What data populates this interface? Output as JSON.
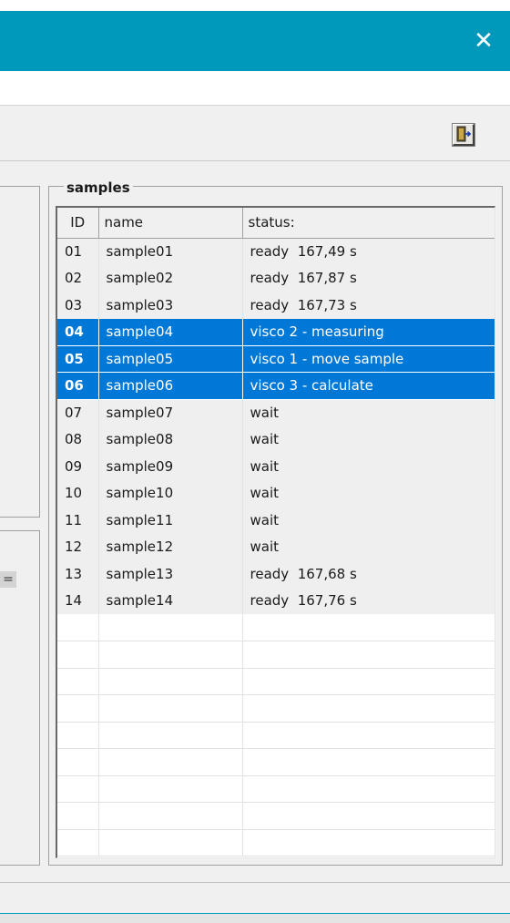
{
  "window": {
    "close_glyph": "✕",
    "accent_color": "#0099bc"
  },
  "toolbar": {
    "exit_icon": "exit-door-icon"
  },
  "side": {
    "tick_label": "="
  },
  "samples": {
    "group_title": "samples",
    "columns": [
      "ID",
      "name",
      "status:"
    ],
    "rows": [
      {
        "id": "01",
        "name": "sample01",
        "status": "ready  167,49 s",
        "selected": false
      },
      {
        "id": "02",
        "name": "sample02",
        "status": "ready  167,87 s",
        "selected": false
      },
      {
        "id": "03",
        "name": "sample03",
        "status": "ready  167,73 s",
        "selected": false
      },
      {
        "id": "04",
        "name": "sample04",
        "status": "visco 2 - measuring",
        "selected": true
      },
      {
        "id": "05",
        "name": "sample05",
        "status": "visco 1 - move sample",
        "selected": true
      },
      {
        "id": "06",
        "name": "sample06",
        "status": "visco 3 - calculate",
        "selected": true
      },
      {
        "id": "07",
        "name": "sample07",
        "status": "wait",
        "selected": false
      },
      {
        "id": "08",
        "name": "sample08",
        "status": "wait",
        "selected": false
      },
      {
        "id": "09",
        "name": "sample09",
        "status": "wait",
        "selected": false
      },
      {
        "id": "10",
        "name": "sample10",
        "status": "wait",
        "selected": false
      },
      {
        "id": "11",
        "name": "sample11",
        "status": "wait",
        "selected": false
      },
      {
        "id": "12",
        "name": "sample12",
        "status": "wait",
        "selected": false
      },
      {
        "id": "13",
        "name": "sample13",
        "status": "ready  167,68 s",
        "selected": false
      },
      {
        "id": "14",
        "name": "sample14",
        "status": "ready  167,76 s",
        "selected": false
      }
    ],
    "selection_color": "#0078d7"
  }
}
